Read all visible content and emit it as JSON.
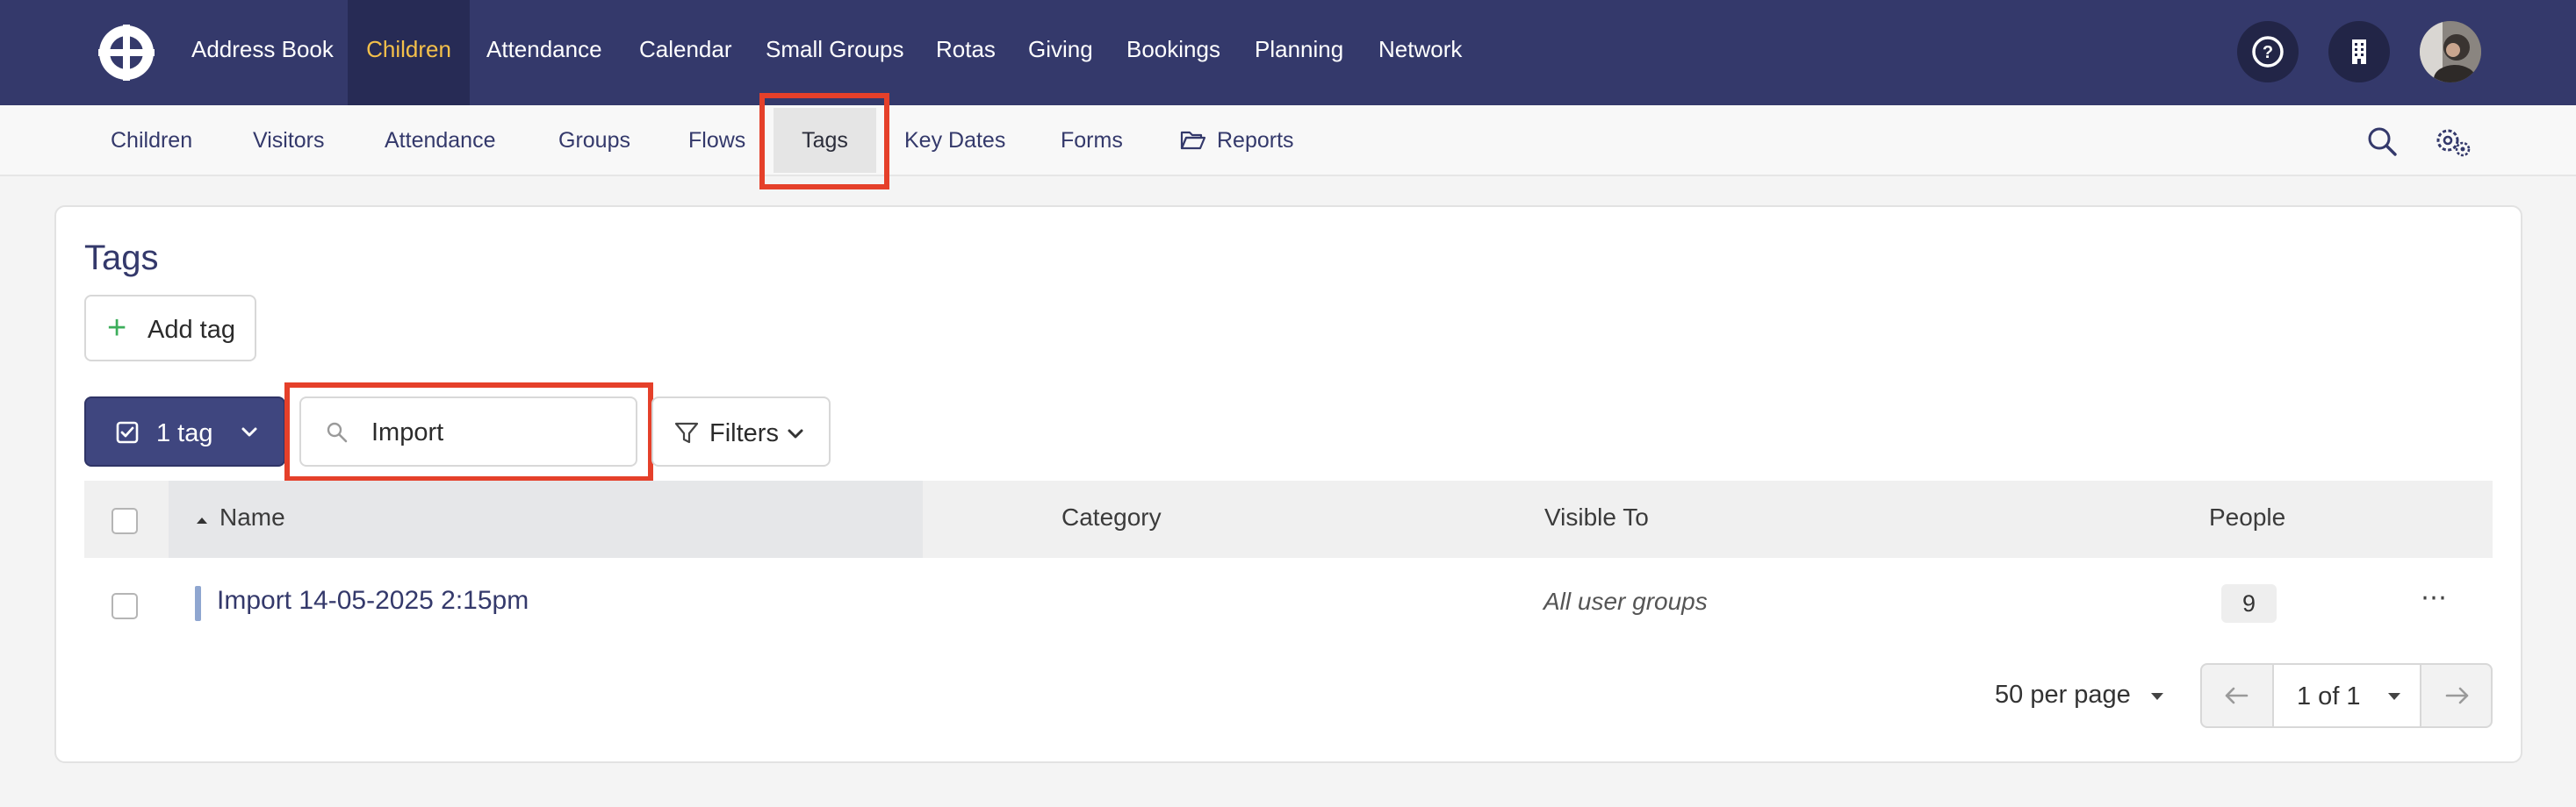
{
  "topnav": {
    "items": [
      {
        "label": "Address Book"
      },
      {
        "label": "Children"
      },
      {
        "label": "Attendance"
      },
      {
        "label": "Calendar"
      },
      {
        "label": "Small Groups"
      },
      {
        "label": "Rotas"
      },
      {
        "label": "Giving"
      },
      {
        "label": "Bookings"
      },
      {
        "label": "Planning"
      },
      {
        "label": "Network"
      }
    ],
    "active_index": 1
  },
  "subnav": {
    "items": [
      {
        "label": "Children"
      },
      {
        "label": "Visitors"
      },
      {
        "label": "Attendance"
      },
      {
        "label": "Groups"
      },
      {
        "label": "Flows"
      },
      {
        "label": "Tags"
      },
      {
        "label": "Key Dates"
      },
      {
        "label": "Forms"
      },
      {
        "label": "Reports"
      }
    ],
    "active_index": 5
  },
  "page": {
    "title": "Tags",
    "add_tag_label": "Add tag",
    "selection_label": "1 tag",
    "search_value": "Import",
    "filters_label": "Filters"
  },
  "table": {
    "columns": {
      "name": "Name",
      "category": "Category",
      "visible_to": "Visible To",
      "people": "People"
    },
    "rows": [
      {
        "name": "Import 14-05-2025 2:15pm",
        "category": "",
        "visible_to": "All user groups",
        "people": "9"
      }
    ]
  },
  "pagination": {
    "per_page": "50 per page",
    "page_label": "1 of 1"
  },
  "colors": {
    "brand": "#34396b",
    "active_nav": "#f4c04a",
    "highlight": "#e5402a",
    "add": "#3dae5b"
  }
}
